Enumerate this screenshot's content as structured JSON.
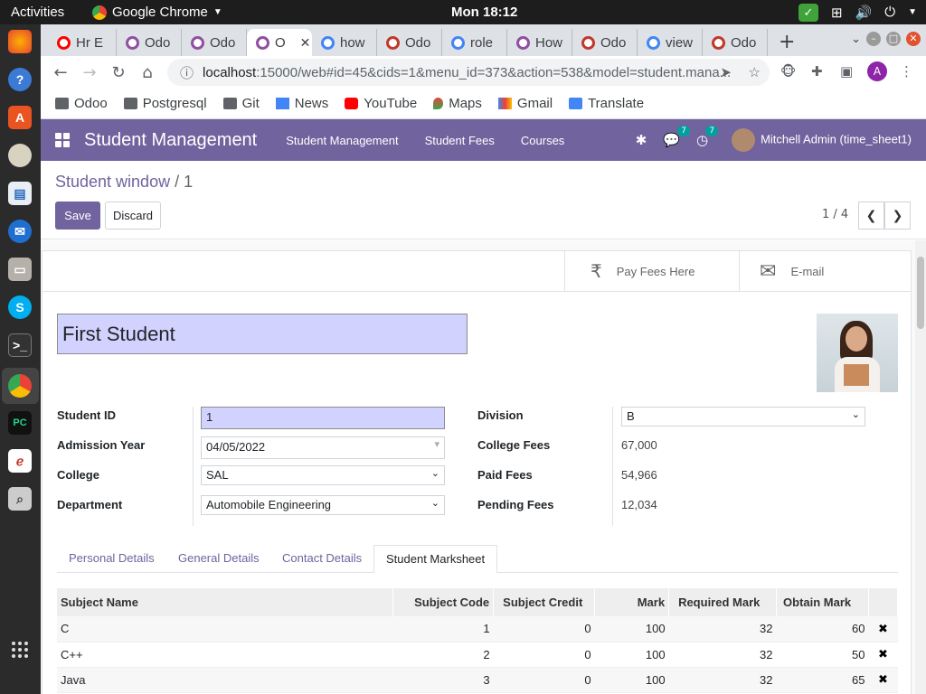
{
  "system": {
    "activities": "Activities",
    "app_name": "Google Chrome",
    "clock": "Mon 18:12"
  },
  "dock": [
    "firefox-icon",
    "help-icon",
    "app-store-icon",
    "audio-player-icon",
    "text-editor-icon",
    "thunderbird-icon",
    "files-icon",
    "skype-icon",
    "terminal-icon",
    "chrome-icon",
    "pycharm-icon",
    "document-viewer-icon",
    "screenshot-icon"
  ],
  "browser": {
    "tabs": [
      {
        "label": "Hr E",
        "color": "#ff0000"
      },
      {
        "label": "Odo",
        "color": "#8f4fa2"
      },
      {
        "label": "Odo",
        "color": "#8f4fa2"
      },
      {
        "label": "O",
        "color": "#8f4fa2",
        "active": true
      },
      {
        "label": "how",
        "color": "#4285f4"
      },
      {
        "label": "Odo",
        "color": "#c0392b"
      },
      {
        "label": "role",
        "color": "#4285f4"
      },
      {
        "label": "How",
        "color": "#8f4fa2"
      },
      {
        "label": "Odo",
        "color": "#c0392b"
      },
      {
        "label": "view",
        "color": "#4285f4"
      },
      {
        "label": "Odo",
        "color": "#c0392b"
      }
    ],
    "url_host": "localhost",
    "url_rest": ":15000/web#id=45&cids=1&menu_id=373&action=538&model=student.mana...",
    "profile_initial": "A",
    "bookmarks": [
      {
        "label": "Odoo",
        "icon": "folder-icon"
      },
      {
        "label": "Postgresql",
        "icon": "folder-icon"
      },
      {
        "label": "Git",
        "icon": "folder-icon"
      },
      {
        "label": "News",
        "icon": "news-icon"
      },
      {
        "label": "YouTube",
        "icon": "youtube-icon"
      },
      {
        "label": "Maps",
        "icon": "maps-icon"
      },
      {
        "label": "Gmail",
        "icon": "gmail-icon"
      },
      {
        "label": "Translate",
        "icon": "translate-icon"
      }
    ]
  },
  "odoo": {
    "brand": "Student Management",
    "menu": [
      "Student Management",
      "Student Fees",
      "Courses"
    ],
    "messages_count": "7",
    "activities_count": "7",
    "user": "Mitchell Admin (time_sheet1)",
    "accent": "#71639e"
  },
  "control": {
    "breadcrumb_link": "Student window",
    "breadcrumb_sep": " / ",
    "breadcrumb_current": "1",
    "save": "Save",
    "discard": "Discard",
    "pager": "1 / 4"
  },
  "form": {
    "pay_fees": "Pay Fees Here",
    "email": "E-mail",
    "name": "First Student",
    "left": [
      {
        "label": "Student ID",
        "value": "1"
      },
      {
        "label": "Admission Year",
        "value": "04/05/2022"
      },
      {
        "label": "College",
        "value": "SAL"
      },
      {
        "label": "Department",
        "value": "Automobile Engineering"
      }
    ],
    "right": [
      {
        "label": "Division",
        "value": "B"
      },
      {
        "label": "College Fees",
        "value": "67,000"
      },
      {
        "label": "Paid Fees",
        "value": "54,966"
      },
      {
        "label": "Pending Fees",
        "value": "12,034"
      }
    ],
    "tabs": [
      "Personal Details",
      "General Details",
      "Contact Details",
      "Student Marksheet"
    ],
    "active_tab": "Student Marksheet",
    "marksheet": {
      "headers": [
        "Subject Name",
        "Subject Code",
        "Subject Credit",
        "Mark",
        "Required Mark",
        "Obtain Mark"
      ],
      "rows": [
        [
          "C",
          "1",
          "0",
          "100",
          "32",
          "60"
        ],
        [
          "C++",
          "2",
          "0",
          "100",
          "32",
          "50"
        ],
        [
          "Java",
          "3",
          "0",
          "100",
          "32",
          "65"
        ]
      ]
    }
  }
}
